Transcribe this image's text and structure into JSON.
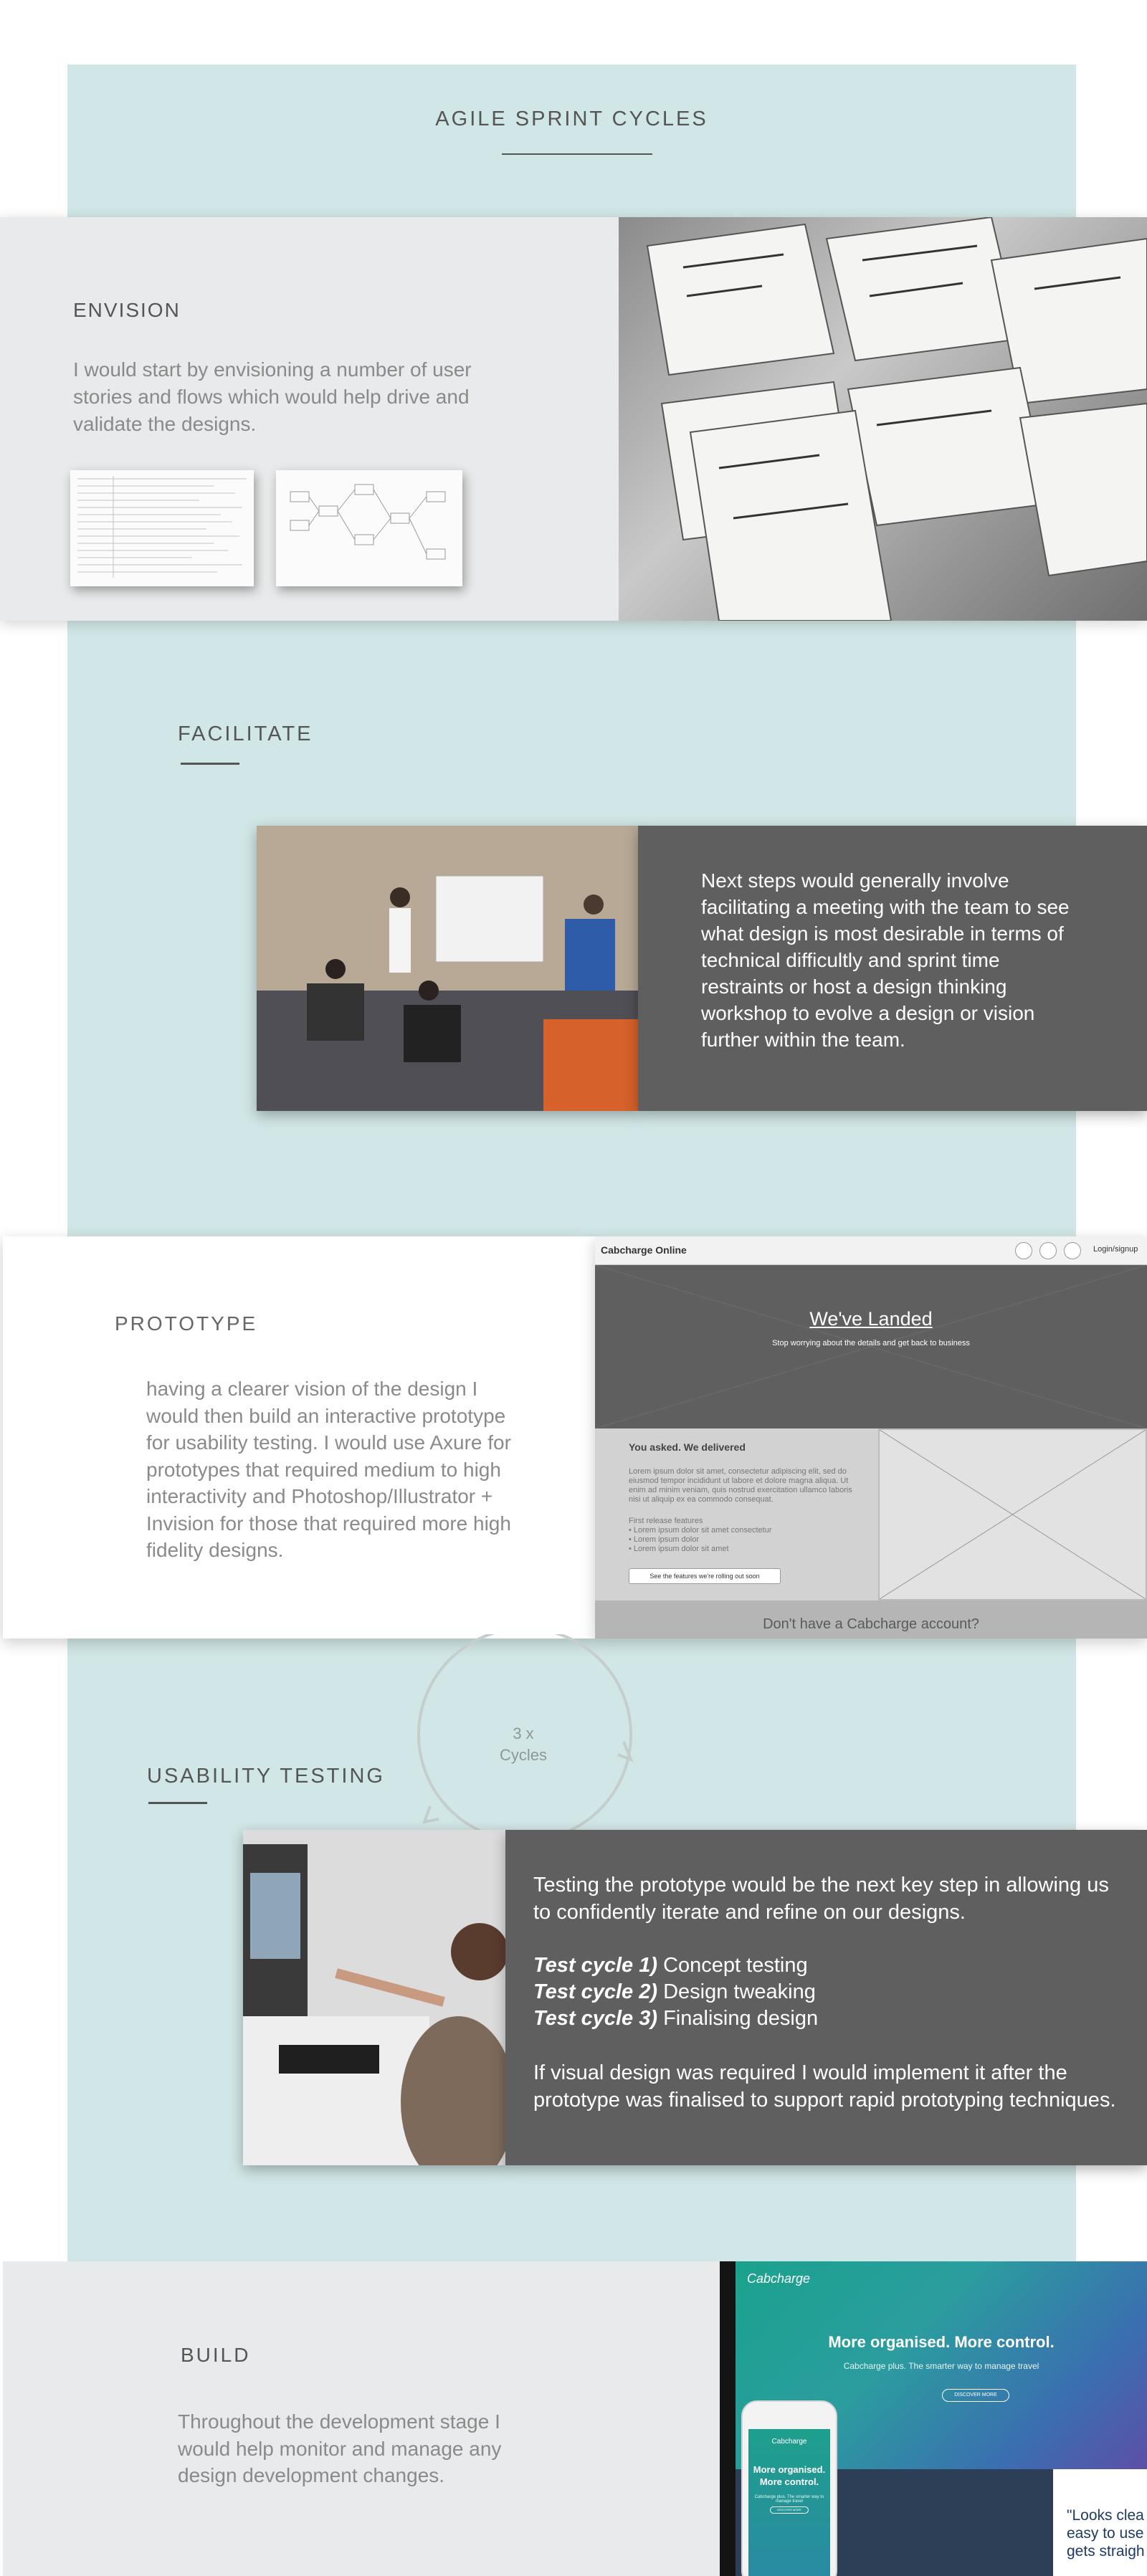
{
  "page": {
    "title": "AGILE SPRINT CYCLES"
  },
  "envision": {
    "heading": "ENVISION",
    "text": "I would start by envisioning a number of user stories and flows which would help drive and validate the designs."
  },
  "facilitate": {
    "heading": "FACILITATE",
    "text": "Next steps would generally involve facilitating a meeting with the team to see what design is most desirable in terms of technical difficultly and sprint time restraints or host a design thinking workshop to evolve a design or vision further within the team."
  },
  "prototype": {
    "heading": "PROTOTYPE",
    "text": "having a clearer vision of the design I would then build an interactive prototype for usability testing.  I would use Axure for prototypes that required medium to high interactivity and Photoshop/Illustrator + Invision for those that required more high fidelity designs.",
    "wireframe": {
      "brand": "Cabcharge Online",
      "login": "Login/signup",
      "hero_title": "We've Landed",
      "hero_sub": "Stop worrying about the details and get back to business",
      "asked": "You asked. We delivered",
      "lorem": "Lorem ipsum dolor sit amet, consectetur adipiscing elit, sed do eiusmod tempor incididunt ut labore et dolore magna aliqua. Ut enim ad minim veniam, quis nostrud exercitation ullamco laboris nisi ut aliquip ex ea commodo consequat.",
      "features": "First release features\n• Lorem ipsum dolor sit amet consectetur\n• Lorem ipsum dolor\n• Lorem ipsum dolor sit amet",
      "button": "See the features we're rolling out soon",
      "bottom": "Don't have a Cabcharge account?"
    }
  },
  "cycles": {
    "label": "3 x\nCycles"
  },
  "usability": {
    "heading": "USABILITY TESTING",
    "intro": "Testing the prototype would be the next key step in allowing us to confidently iterate and refine on our designs.",
    "cycles": [
      {
        "label": "Test cycle 1)",
        "text": " Concept testing"
      },
      {
        "label": "Test cycle 2)",
        "text": " Design tweaking"
      },
      {
        "label": "Test cycle 3)",
        "text": " Finalising design"
      }
    ],
    "outro": "If visual design was required I would implement it after the prototype was finalised to support rapid prototyping techniques."
  },
  "build": {
    "heading": "BUILD",
    "text": "Throughout the development stage I would help monitor and manage any design development changes.",
    "mock": {
      "logo": "Cabcharge",
      "headline": "More organised. More control.",
      "sub": "Cabcharge plus. The smarter way to manage travel",
      "button": "DISCOVER MORE",
      "quote": "\"Looks clea\neasy to use\ngets straigh",
      "phone_headline": "More organised.\nMore control."
    }
  },
  "colors": {
    "teal_bg": "#d1e6e6",
    "panel_dark": "#5f5f5f",
    "card_light": "#e9eaeb"
  }
}
